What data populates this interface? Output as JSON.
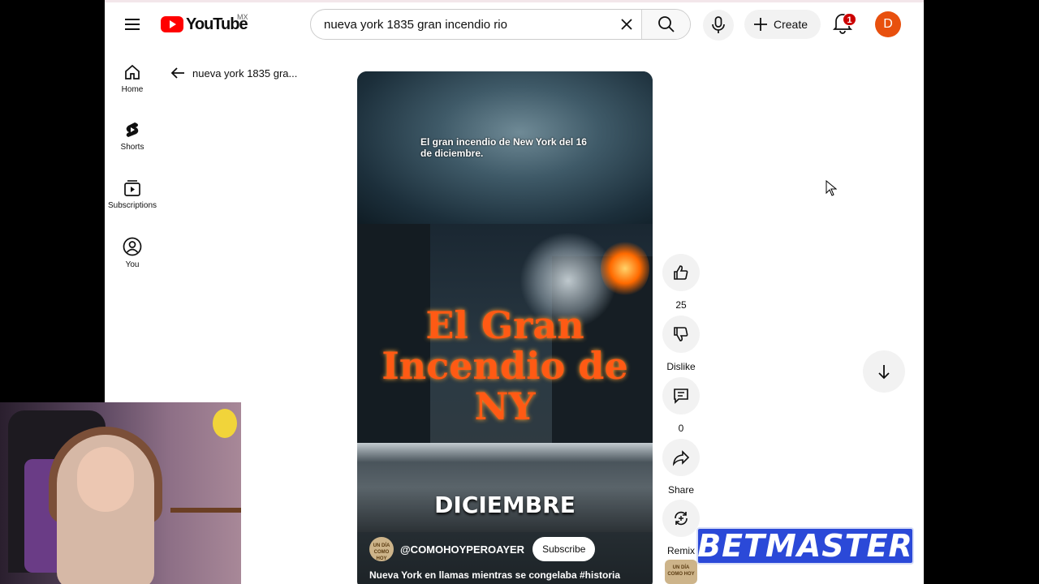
{
  "header": {
    "logo_text": "YouTube",
    "country_code": "MX",
    "search_value": "nueva york 1835 gran incendio rio",
    "create_label": "Create",
    "notification_count": "1",
    "avatar_letter": "D"
  },
  "sidebar": {
    "items": [
      {
        "label": "Home",
        "icon": "home-icon"
      },
      {
        "label": "Shorts",
        "icon": "shorts-icon"
      },
      {
        "label": "Subscriptions",
        "icon": "subscriptions-icon"
      },
      {
        "label": "You",
        "icon": "you-icon"
      }
    ]
  },
  "breadcrumb": {
    "query": "nueva york 1835 gra..."
  },
  "short": {
    "caption": "El gran incendio de New York del 16 de diciembre.",
    "title_art": "El Gran Incendio de NY",
    "month_text": "DICIEMBRE",
    "channel_name": "@COMOHOYPEROAYER",
    "channel_avatar_text": "UN DÍA COMO HOY",
    "subscribe_label": "Subscribe",
    "description": "Nueva York en llamas mientras se congelaba #historia"
  },
  "actions": {
    "like_count": "25",
    "dislike_label": "Dislike",
    "comment_count": "0",
    "share_label": "Share",
    "remix_label": "Remix"
  },
  "overlay": {
    "brand": "BETMASTER"
  },
  "colors": {
    "brand_red": "#ff0000",
    "overlay_blue": "#2b49d8",
    "avatar": "#e8500e"
  }
}
